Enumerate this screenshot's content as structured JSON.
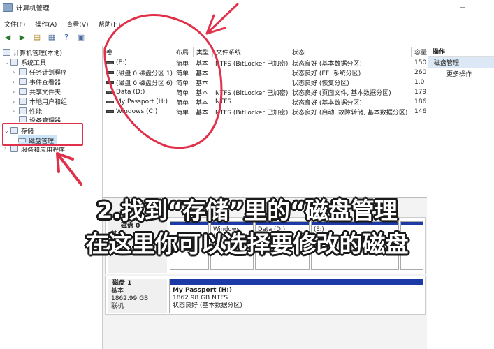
{
  "window": {
    "title": "计算机管理"
  },
  "menu": [
    "文件(F)",
    "操作(A)",
    "查看(V)",
    "帮助(H)"
  ],
  "tree": {
    "root": "计算机管理(本地)",
    "system_tools": "系统工具",
    "task_scheduler": "任务计划程序",
    "event_viewer": "事件查看器",
    "shared_folders": "共享文件夹",
    "local_users": "本地用户和组",
    "performance": "性能",
    "device_manager": "设备管理器",
    "storage": "存储",
    "disk_management": "磁盘管理",
    "services": "服务和应用程序"
  },
  "columns": [
    "卷",
    "布局",
    "类型",
    "文件系统",
    "状态",
    "容量"
  ],
  "volumes": [
    {
      "name": "(E:)",
      "layout": "简单",
      "type": "基本",
      "fs": "NTFS (BitLocker 已加密)",
      "status": "状态良好 (基本数据分区)",
      "cap": "150"
    },
    {
      "name": "(磁盘 0 磁盘分区 1)",
      "layout": "简单",
      "type": "基本",
      "fs": "",
      "status": "状态良好 (EFI 系统分区)",
      "cap": "260"
    },
    {
      "name": "(磁盘 0 磁盘分区 6)",
      "layout": "简单",
      "type": "基本",
      "fs": "",
      "status": "状态良好 (恢复分区)",
      "cap": "1.0"
    },
    {
      "name": "Data (D:)",
      "layout": "简单",
      "type": "基本",
      "fs": "NTFS (BitLocker 已加密)",
      "status": "状态良好 (页面文件, 基本数据分区)",
      "cap": "179"
    },
    {
      "name": "My Passport (H:)",
      "layout": "简单",
      "type": "基本",
      "fs": "NTFS",
      "status": "状态良好 (基本数据分区)",
      "cap": "186"
    },
    {
      "name": "Windows (C:)",
      "layout": "简单",
      "type": "基本",
      "fs": "NTFS (BitLocker 已加密)",
      "status": "状态良好 (启动, 故障转储, 基本数据分区)",
      "cap": "146"
    }
  ],
  "actions": {
    "header": "操作",
    "section": "磁盘管理",
    "more": "更多操作"
  },
  "disk0": {
    "name": "磁盘 0",
    "type": "基本",
    "parts": [
      "Windows (C:)",
      "Data (D:)",
      "(E:)"
    ]
  },
  "disk1": {
    "name": "磁盘 1",
    "type": "基本",
    "size": "1862.99 GB",
    "state": "联机",
    "part_name": "My Passport  (H:)",
    "part_size": "1862.98 GB NTFS",
    "part_status": "状态良好 (基本数据分区)"
  },
  "overlay": {
    "line1": "2.找到“存储”里的“磁盘管理",
    "line2": "在这里你可以选择要修改的磁盘"
  },
  "colors": {
    "annotation": "#e0304a",
    "partition_bar": "#1b3aa8",
    "selected": "#cce4f7"
  }
}
